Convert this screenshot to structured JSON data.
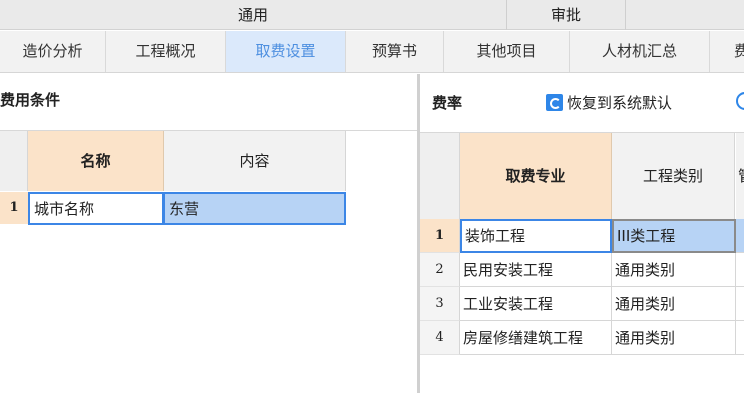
{
  "groups": {
    "general": "通用",
    "review": "审批"
  },
  "tabs": [
    {
      "label": "造价分析",
      "active": false
    },
    {
      "label": "工程概况",
      "active": false
    },
    {
      "label": "取费设置",
      "active": true
    },
    {
      "label": "预算书",
      "active": false
    },
    {
      "label": "其他项目",
      "active": false
    },
    {
      "label": "人材机汇总",
      "active": false
    },
    {
      "label": "费",
      "active": false
    }
  ],
  "left_panel": {
    "title": "费用条件",
    "columns": [
      "名称",
      "内容"
    ],
    "rows": [
      {
        "no": "1",
        "name": "城市名称",
        "content": "东营"
      }
    ]
  },
  "right_panel": {
    "title": "费率",
    "restore_label": "恢复到系统默认",
    "columns": [
      "取费专业",
      "工程类别",
      "管"
    ],
    "rows": [
      {
        "no": "1",
        "major": "装饰工程",
        "type": "III类工程"
      },
      {
        "no": "2",
        "major": "民用安装工程",
        "type": "通用类别"
      },
      {
        "no": "3",
        "major": "工业安装工程",
        "type": "通用类别"
      },
      {
        "no": "4",
        "major": "房屋修缮建筑工程",
        "type": "通用类别"
      }
    ]
  },
  "colors": {
    "active_tab_bg": "#dbe9fb",
    "active_tab_text": "#4d8fe0",
    "header_highlight": "#fbe3c9",
    "selection_border": "#3c86e6",
    "selection_fill": "#b7d3f5",
    "icon_blue": "#2e86e8"
  },
  "icons": {
    "restore": "restore-icon"
  }
}
